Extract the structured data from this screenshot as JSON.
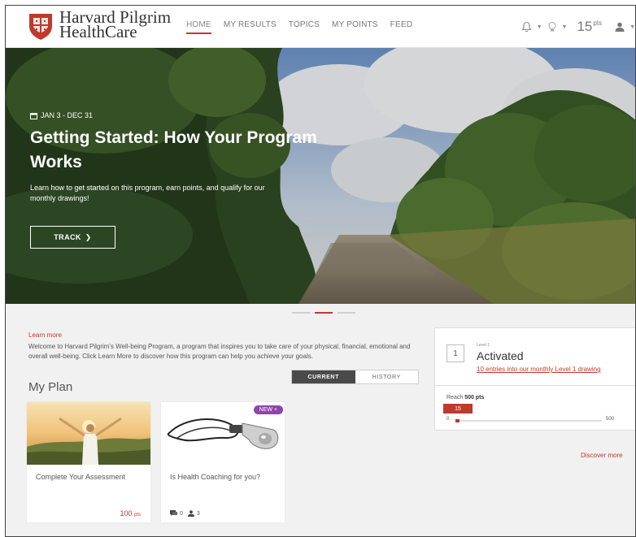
{
  "brand": {
    "line1": "Harvard Pilgrim",
    "line2": "HealthCare",
    "color": "#c0392b"
  },
  "nav": {
    "items": [
      {
        "label": "HOME",
        "active": true
      },
      {
        "label": "MY RESULTS"
      },
      {
        "label": "TOPICS"
      },
      {
        "label": "MY POINTS"
      },
      {
        "label": "FEED"
      }
    ]
  },
  "header": {
    "points_value": "15",
    "points_unit": "pts"
  },
  "hero": {
    "date_range": "JAN 3 - DEC 31",
    "title": "Getting Started: How Your Program Works",
    "description": "Learn how to get started on this program, earn points, and qualify for our monthly drawings!",
    "button_label": "TRACK"
  },
  "intro": {
    "learn_more": "Learn more",
    "text": "Welcome to Harvard Pilgrim's Well-being Program, a program that inspires you to take care of your physical, financial, emotional and overall well-being. Click Learn More to discover how this program can help you achieve your goals."
  },
  "plan": {
    "title": "My Plan",
    "tabs": {
      "current": "CURRENT",
      "history": "HISTORY"
    },
    "cards": [
      {
        "title": "Complete Your Assessment",
        "points": "100",
        "points_unit": "pts"
      },
      {
        "title": "Is Health Coaching for you?",
        "badge": "NEW",
        "comments": "0",
        "participants": "3"
      }
    ]
  },
  "level": {
    "number": "1",
    "label": "Level 1",
    "name": "Activated",
    "link": "10 entries into our monthly Level 1 drawing",
    "reach_prefix": "Reach",
    "reach_target": "500 pts",
    "current": "15",
    "min": "0",
    "max": "500",
    "progress": 0.03
  },
  "discover": "Discover more",
  "colors": {
    "accent": "#c0392b",
    "badge": "#8e44ad",
    "toggle_active": "#4a4a4a"
  }
}
